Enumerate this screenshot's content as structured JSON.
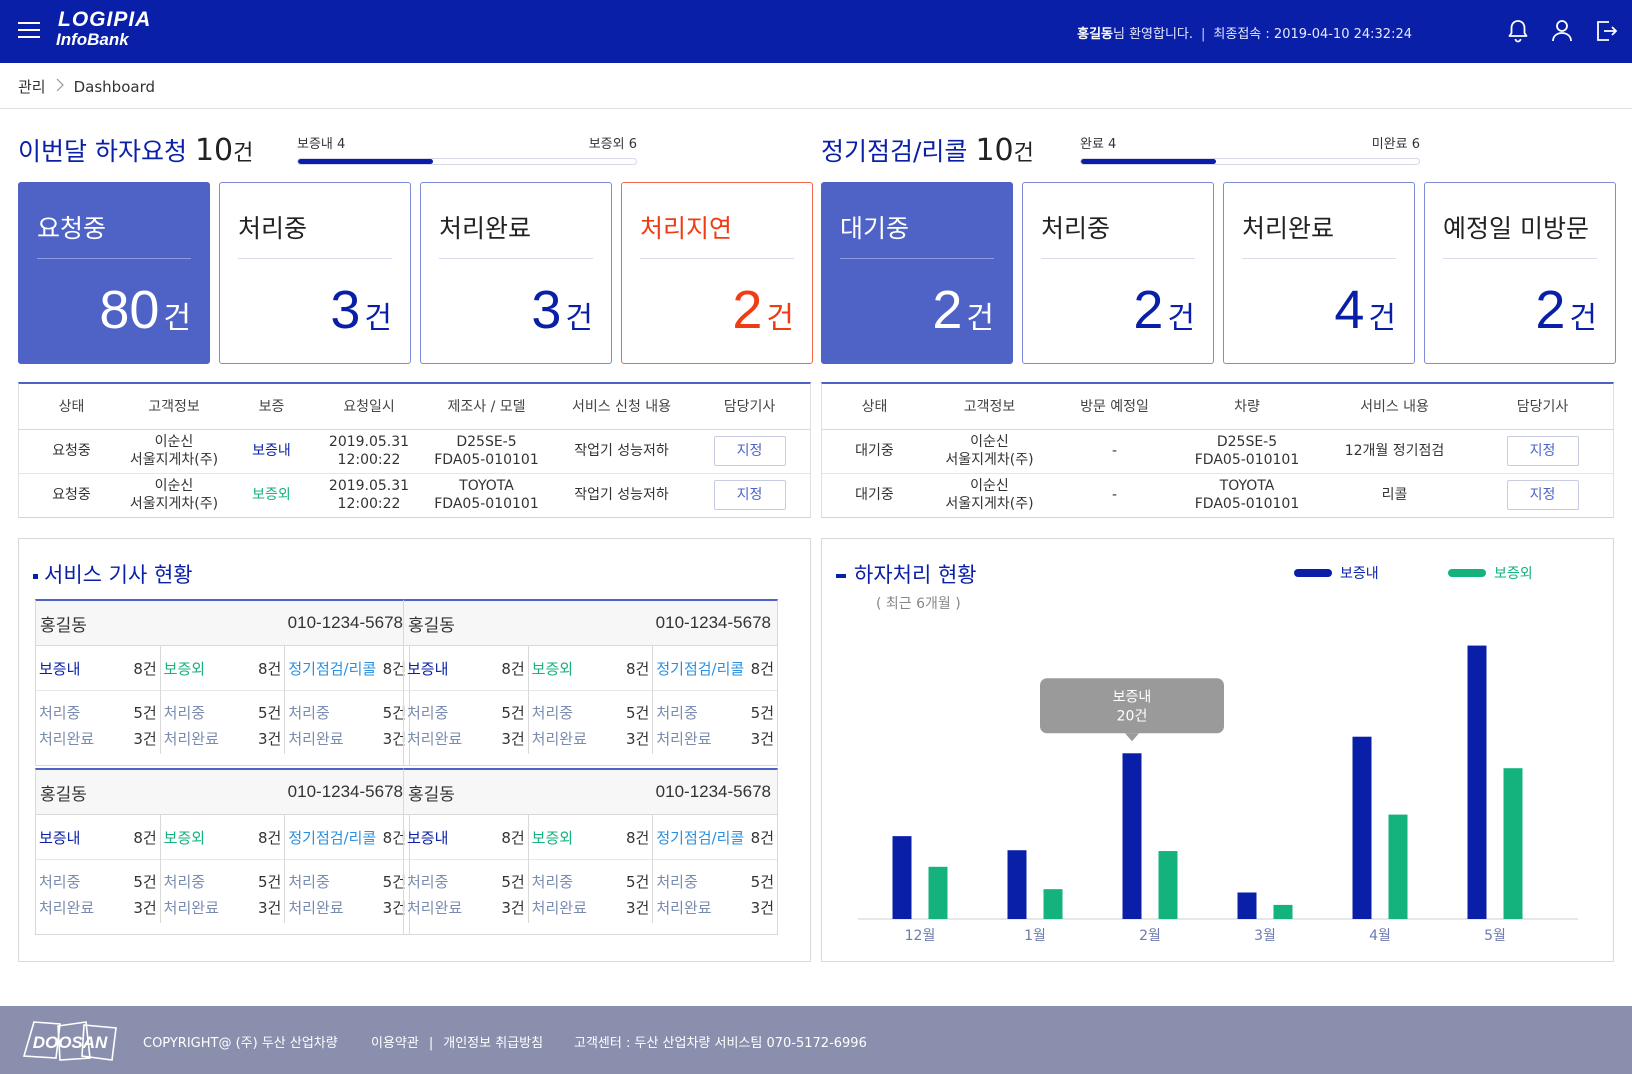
{
  "header": {
    "logo_line1": "LOGIPIA",
    "logo_line2": "InfoBank",
    "user_name": "홍길동",
    "welcome_suffix": "님 환영합니다.",
    "last_login_label": "최종접속 : ",
    "last_login_value": "2019-04-10 24:32:24",
    "icons": [
      "menu-icon",
      "bell-icon",
      "user-icon",
      "logout-icon"
    ]
  },
  "breadcrumb": [
    "관리",
    "Dashboard"
  ],
  "defect_summary": {
    "title": "이번달 하자요청",
    "count": "10",
    "unit": "건",
    "left_label": "보증내 4",
    "right_label": "보증외 6",
    "progress": 0.4
  },
  "inspection_summary": {
    "title": "정기점검/리콜",
    "count": "10",
    "unit": "건",
    "left_label": "완료 4",
    "right_label": "미완료 6",
    "progress": 0.4
  },
  "defect_cards": [
    {
      "label": "요청중",
      "value": "80",
      "unit": "건",
      "style": "active"
    },
    {
      "label": "처리중",
      "value": "3",
      "unit": "건",
      "style": "normal"
    },
    {
      "label": "처리완료",
      "value": "3",
      "unit": "건",
      "style": "normal"
    },
    {
      "label": "처리지연",
      "value": "2",
      "unit": "건",
      "style": "delay"
    }
  ],
  "inspection_cards": [
    {
      "label": "대기중",
      "value": "2",
      "unit": "건",
      "style": "active"
    },
    {
      "label": "처리중",
      "value": "2",
      "unit": "건",
      "style": "normal"
    },
    {
      "label": "처리완료",
      "value": "4",
      "unit": "건",
      "style": "normal"
    },
    {
      "label": "예정일 미방문",
      "value": "2",
      "unit": "건",
      "style": "normal"
    }
  ],
  "defect_table": {
    "headers": [
      "상태",
      "고객정보",
      "보증",
      "요청일시",
      "제조사 / 모델",
      "서비스 신청 내용",
      "담당기사"
    ],
    "rows": [
      {
        "status": "요청중",
        "customer_name": "이순신",
        "customer_company": "서울지게차(주)",
        "warranty": "보증내",
        "date": "2019.05.31",
        "time": "12:00:22",
        "maker": "D25SE-5",
        "model": "FDA05-010101",
        "request": "작업기 성능저하",
        "button": "지정"
      },
      {
        "status": "요청중",
        "customer_name": "이순신",
        "customer_company": "서울지게차(주)",
        "warranty": "보증외",
        "date": "2019.05.31",
        "time": "12:00:22",
        "maker": "TOYOTA",
        "model": "FDA05-010101",
        "request": "작업기 성능저하",
        "button": "지정"
      }
    ]
  },
  "inspection_table": {
    "headers": [
      "상태",
      "고객정보",
      "방문 예정일",
      "차량",
      "서비스 내용",
      "담당기사"
    ],
    "rows": [
      {
        "status": "대기중",
        "customer_name": "이순신",
        "customer_company": "서울지게차(주)",
        "visit_date": "-",
        "vehicle": "D25SE-5",
        "vehicle_no": "FDA05-010101",
        "service": "12개월 정기점검",
        "button": "지정"
      },
      {
        "status": "대기중",
        "customer_name": "이순신",
        "customer_company": "서울지게차(주)",
        "visit_date": "-",
        "vehicle": "TOYOTA",
        "vehicle_no": "FDA05-010101",
        "service": "리콜",
        "button": "지정"
      }
    ]
  },
  "technicians": {
    "title": "서비스 기사 현황",
    "cards": [
      {
        "name": "홍길동",
        "phone": "010-1234-5678"
      },
      {
        "name": "홍길동",
        "phone": "010-1234-5678"
      },
      {
        "name": "홍길동",
        "phone": "010-1234-5678"
      },
      {
        "name": "홍길동",
        "phone": "010-1234-5678"
      }
    ],
    "columns": [
      {
        "label": "보증내",
        "total": "8건",
        "in_progress_label": "처리중",
        "in_progress": "5건",
        "done_label": "처리완료",
        "done": "3건"
      },
      {
        "label": "보증외",
        "total": "8건",
        "in_progress_label": "처리중",
        "in_progress": "5건",
        "done_label": "처리완료",
        "done": "3건"
      },
      {
        "label": "정기점검/리콜",
        "total": "8건",
        "in_progress_label": "처리중",
        "in_progress": "5건",
        "done_label": "처리완료",
        "done": "3건"
      }
    ]
  },
  "defect_chart": {
    "title": "하자처리 현황",
    "subtitle": "( 최근 6개월 )",
    "tooltip_series": "보증내",
    "tooltip_value": "20건"
  },
  "chart_data": {
    "type": "bar",
    "categories": [
      "12월",
      "1월",
      "2월",
      "3월",
      "4월",
      "5월"
    ],
    "series": [
      {
        "name": "보증내",
        "color": "#0a1fa8",
        "values": [
          10,
          8.3,
          20,
          3.2,
          22,
          33
        ]
      },
      {
        "name": "보증외",
        "color": "#14b37d",
        "values": [
          6.3,
          3.6,
          8.2,
          1.7,
          12.6,
          18.2
        ]
      }
    ],
    "ylim": [
      0,
      35
    ],
    "legend": "top-right",
    "grid": false,
    "highlight": {
      "category": "2월",
      "series": "보증내"
    }
  },
  "footer": {
    "logo_text": "DOOSAN",
    "copyright": "COPYRIGHT@ (주) 두산 산업차량",
    "terms": "이용약관",
    "privacy": "개인정보 취급방침",
    "service_center": "고객센터 : 두산 산업차량 서비스팀 070-5172-6996"
  }
}
